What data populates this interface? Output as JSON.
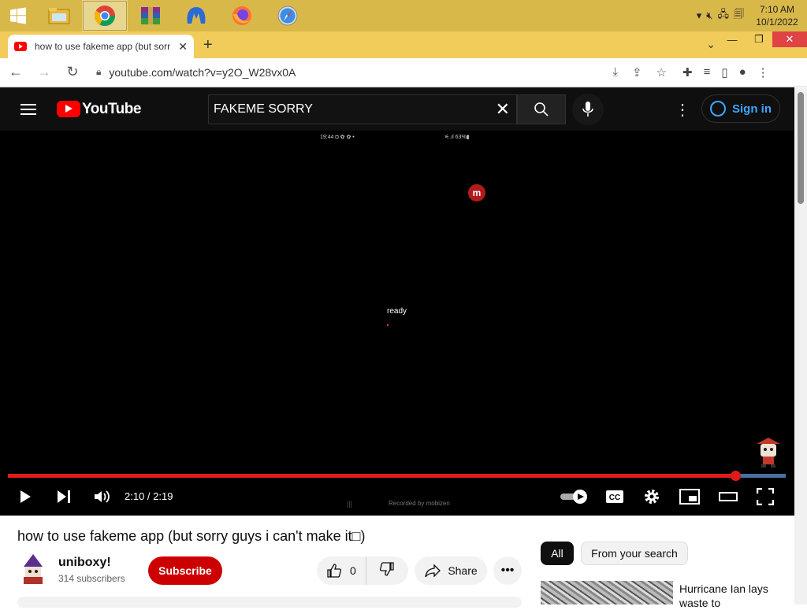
{
  "taskbar": {
    "apps": [
      "file-explorer",
      "chrome",
      "winrar",
      "malwarebytes",
      "firefox",
      "safari"
    ],
    "clock_time": "7:10 AM",
    "clock_date": "10/1/2022"
  },
  "browser": {
    "tab_title": "how to use fakeme app (but sorry guys i can't make it)",
    "url": "youtube.com/watch?v=y2O_W28vx0A"
  },
  "youtube": {
    "logo_text": "YouTube",
    "search_query": "FAKEME SORRY",
    "sign_in_label": "Sign in"
  },
  "player": {
    "status_left": "19:44 ◘ ✿ ✿ •",
    "status_right": "⚟.ıl 63%▮",
    "badge_letter": "m",
    "overlay_text": "ready",
    "elapsed": "2:10",
    "duration": "2:19",
    "time_display": "2:10 / 2:19",
    "progress_fraction": 0.935,
    "recorded_by": "Recorded by mobizen",
    "cc_label": "CC",
    "autoplay_on": true
  },
  "video": {
    "title": "how to use fakeme app (but sorry guys i can't make it□)",
    "channel_name": "uniboxy!",
    "subscribers": "314 subscribers",
    "subscribe_label": "Subscribe",
    "like_count": "0",
    "share_label": "Share"
  },
  "sidebar": {
    "chips": [
      "All",
      "From your search"
    ],
    "recommendation_title": "Hurricane Ian lays waste to"
  },
  "colors": {
    "taskbar": "#d9b84a",
    "tabstrip": "#f1cc5b",
    "youtube_red": "#ff0000",
    "progress_played": "#e01b1b",
    "signin_blue": "#3ea6ff"
  }
}
